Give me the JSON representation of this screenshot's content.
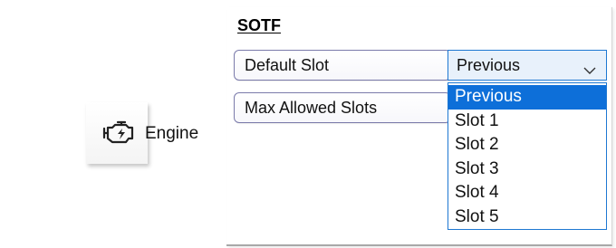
{
  "engine_tab": {
    "label": "Engine",
    "icon": "engine-icon"
  },
  "sotf": {
    "title": "SOTF",
    "default_slot_label": "Default Slot",
    "max_allowed_slots_label": "Max Allowed Slots",
    "default_slot_value": "Previous",
    "options": [
      "Previous",
      "Slot 1",
      "Slot 2",
      "Slot 3",
      "Slot 4",
      "Slot 5"
    ],
    "highlighted_option": "Previous"
  },
  "colors": {
    "accent": "#0d6fd9",
    "field_border": "#7a7aaa",
    "dropdown_border": "#1e78d2"
  }
}
